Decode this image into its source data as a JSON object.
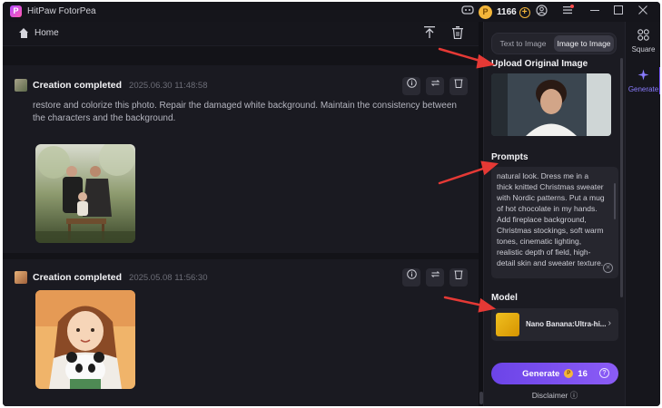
{
  "titlebar": {
    "app_title": "HitPaw FotorPea",
    "credits": "1166",
    "icons": [
      "discord-icon",
      "coin-icon",
      "add-credits-icon",
      "account-icon",
      "menu-icon",
      "minimize-icon",
      "maximize-icon",
      "close-icon"
    ]
  },
  "homebar": {
    "home_label": "Home"
  },
  "feed": {
    "cards": [
      {
        "title": "Creation completed",
        "date": "2025.06.30   11:48:58",
        "prompt": "restore and colorize this photo. Repair the damaged white background. Maintain the consistency between the characters and the background."
      },
      {
        "title": "Creation completed",
        "date": "2025.05.08   11:56:30",
        "prompt": ""
      }
    ]
  },
  "panel": {
    "tabs": [
      {
        "label": "Text to Image",
        "active": false
      },
      {
        "label": "Image to Image",
        "active": true
      }
    ],
    "upload_label": "Upload Original Image",
    "prompts_label": "Prompts",
    "prompt_text": "natural look. Dress me in a thick knitted Christmas sweater with Nordic patterns. Put a mug of hot chocolate in my hands. Add fireplace background, Christmas stockings, soft warm tones, cinematic lighting, realistic depth of field, high-detail skin and sweater texture.",
    "model_label": "Model",
    "model_name": "Nano Banana:Ultra-hi...",
    "generate_label": "Generate",
    "generate_cost": "16",
    "disclaimer": "Disclaimer"
  },
  "nav": {
    "items": [
      {
        "label": "Square",
        "icon": "grid-icon",
        "active": false
      },
      {
        "label": "Generate",
        "icon": "sparkle-icon",
        "active": true
      }
    ]
  },
  "colors": {
    "accent": "#7b5cff",
    "annotation_arrow": "#e53935",
    "credit_gold": "#f4b63a"
  }
}
